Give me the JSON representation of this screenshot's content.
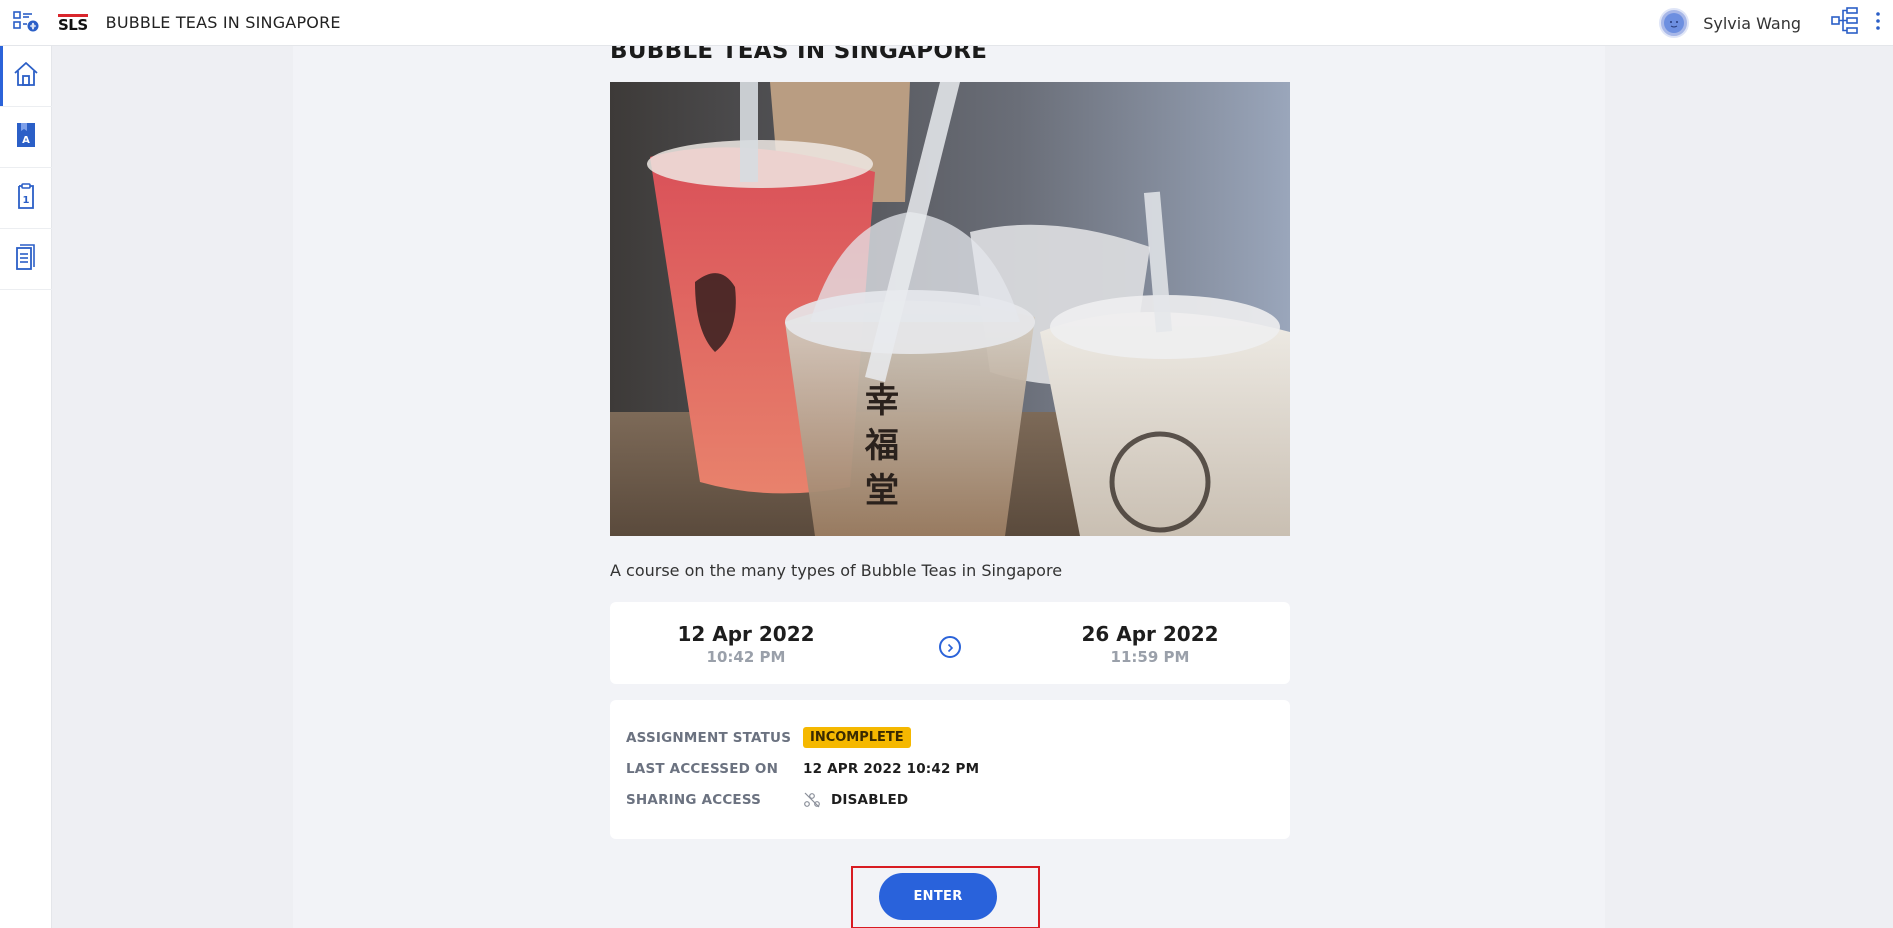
{
  "header": {
    "logo_text": "SLS",
    "title": "BUBBLE TEAS IN SINGAPORE",
    "user_name": "Sylvia Wang",
    "icons": [
      "apps-menu-icon",
      "avatar",
      "structure-icon",
      "more-vertical-icon"
    ]
  },
  "sidebar": {
    "items": [
      {
        "icon": "home-icon",
        "active": true
      },
      {
        "icon": "lesson-a-icon",
        "active": false
      },
      {
        "icon": "assessment-1-icon",
        "active": false
      },
      {
        "icon": "document-list-icon",
        "active": false
      }
    ]
  },
  "course": {
    "title": "BUBBLE TEAS IN SINGAPORE",
    "description": "A course on the many types of Bubble Teas in Singapore",
    "start_date": "12 Apr 2022",
    "start_time": "10:42 PM",
    "end_date": "26 Apr 2022",
    "end_time": "11:59 PM"
  },
  "status": {
    "assignment_label": "ASSIGNMENT STATUS",
    "assignment_value": "INCOMPLETE",
    "last_accessed_label": "LAST ACCESSED ON",
    "last_accessed_value": "12 APR 2022 10:42 PM",
    "sharing_label": "SHARING ACCESS",
    "sharing_value": "DISABLED"
  },
  "actions": {
    "enter_label": "ENTER"
  },
  "colors": {
    "accent": "#2962db",
    "badge": "#f5b800",
    "highlight_box": "#d81b22",
    "logo_red": "#d9262c"
  }
}
